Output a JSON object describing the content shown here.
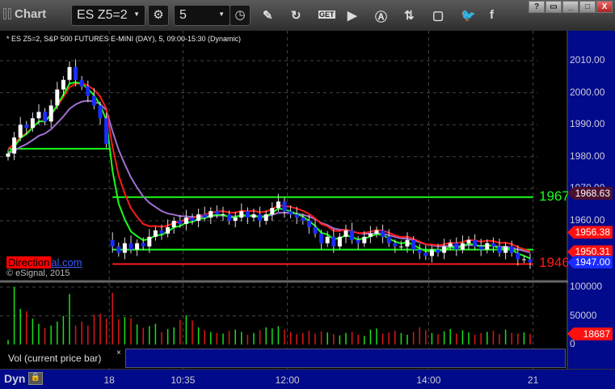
{
  "window": {
    "title": "Chart",
    "symbol": "ES Z5=2",
    "interval": "5",
    "controls": [
      "?",
      "restore",
      "minimize",
      "maximize",
      "X"
    ]
  },
  "toolbar": {
    "icons": [
      "settings-icon",
      "clock-icon",
      "pencil-icon",
      "refresh-icon",
      "get-icon",
      "play-icon",
      "alert-icon",
      "link-icon",
      "chat-icon",
      "twitter-icon",
      "facebook-icon"
    ],
    "get_label": "GET"
  },
  "legend": "* ES Z5=2, S&P 500 FUTURES E-MINI (DAY), 5, 09:00-15:30 (Dynamic)",
  "watermark": {
    "red": "Direction",
    "blue": "al.com"
  },
  "copyright": "© eSignal, 2015",
  "volume_label": "Vol (current price bar)",
  "close_x": "×",
  "bottom": {
    "dyn": "Dyn"
  },
  "colors": {
    "up": "#ffffff",
    "down": "#1a2cff",
    "ma_red": "#ff1a1a",
    "ma_green": "#19ff19",
    "ma_purple": "#a070d0",
    "axis": "#000a8a"
  },
  "chart_data": {
    "type": "candlestick",
    "price_ticks": [
      "2010.00",
      "2000.00",
      "1990.00",
      "1980.00",
      "1970.00",
      "1960.00"
    ],
    "price_values": [
      2010,
      2000,
      1990,
      1980,
      1970,
      1960
    ],
    "time_labels": [
      "18",
      "10:35",
      "12:00",
      "14:00",
      "21"
    ],
    "time_label_index": [
      17,
      29,
      46,
      69,
      86
    ],
    "volume_ticks": [
      "100000",
      "50000",
      "0"
    ],
    "tags": [
      {
        "text": "1968.63",
        "value": 1968.63,
        "color": "#4a1030"
      },
      {
        "text": "1956.38",
        "value": 1956.38,
        "color": "#ff1010"
      },
      {
        "text": "1950.31",
        "value": 1950.31,
        "color": "#ff1010"
      },
      {
        "text": "1947.00",
        "value": 1947.0,
        "color": "#1a2cff"
      },
      {
        "text": "18687",
        "value": 18687,
        "color": "#ff1010",
        "pane": "volume"
      }
    ],
    "level_lines": [
      {
        "value": 1967.4,
        "color": "#19ff19",
        "label": "1967",
        "from": 17
      },
      {
        "value": 1982.5,
        "color": "#19ff19",
        "from": 0,
        "to": 17
      },
      {
        "value": 1951,
        "color": "#19ff19",
        "from": 17
      },
      {
        "value": 1946.5,
        "color": "#ff1a1a",
        "label": "1946",
        "from": 17
      }
    ],
    "closes": [
      1981,
      1986,
      1990,
      1989,
      1992,
      1994,
      1991,
      1996,
      2001,
      2004,
      2008,
      2004,
      2002,
      1999,
      1996,
      1992,
      1984,
      1952,
      1950,
      1953,
      1951,
      1953,
      1952,
      1955,
      1957,
      1956,
      1958,
      1960,
      1959,
      1961,
      1960,
      1962,
      1961,
      1963,
      1962,
      1962,
      1960,
      1961,
      1963,
      1961,
      1962,
      1960,
      1962,
      1964,
      1966,
      1963,
      1962,
      1961,
      1960,
      1958,
      1956,
      1953,
      1955,
      1952,
      1955,
      1957,
      1954,
      1953,
      1955,
      1956,
      1957,
      1955,
      1953,
      1952,
      1952,
      1954,
      1951,
      1950,
      1949,
      1951,
      1950,
      1952,
      1953,
      1951,
      1953,
      1954,
      1952,
      1951,
      1953,
      1952,
      1950,
      1952,
      1950,
      1948,
      1948,
      1947
    ],
    "volumes": [
      8000,
      100000,
      62000,
      58000,
      45000,
      36000,
      29000,
      33000,
      40000,
      50000,
      88000,
      33000,
      40000,
      33000,
      52000,
      54000,
      45000,
      90000,
      44000,
      48000,
      46000,
      35000,
      29000,
      32000,
      36000,
      22000,
      27000,
      30000,
      43000,
      51000,
      42000,
      30000,
      25000,
      22000,
      20000,
      19000,
      24000,
      26000,
      22000,
      17000,
      20000,
      25000,
      30000,
      28000,
      32000,
      26000,
      22000,
      18000,
      20000,
      24000,
      19000,
      23000,
      21000,
      18000,
      16000,
      20000,
      22000,
      17000,
      15000,
      26000,
      28000,
      19000,
      21000,
      24000,
      20000,
      17000,
      22000,
      30000,
      25000,
      20000,
      18000,
      23000,
      27000,
      19000,
      25000,
      21000,
      17000,
      20000,
      22000,
      24000,
      18000,
      26000,
      20000,
      19000,
      21000,
      18687
    ]
  }
}
